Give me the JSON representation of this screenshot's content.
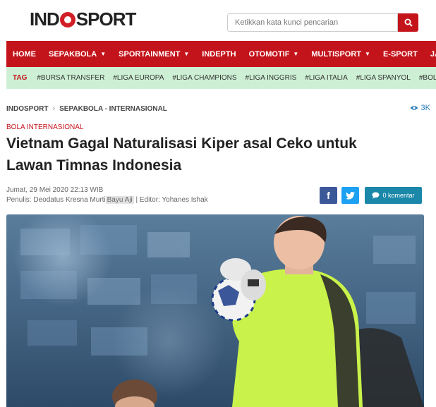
{
  "header": {
    "logo_text_left": "IND",
    "logo_text_right": "SPORT",
    "search_placeholder": "Ketikkan kata kunci pencarian"
  },
  "nav": {
    "items": [
      {
        "label": "HOME",
        "dropdown": false
      },
      {
        "label": "SEPAKBOLA",
        "dropdown": true
      },
      {
        "label": "SPORTAINMENT",
        "dropdown": true
      },
      {
        "label": "INDEPTH",
        "dropdown": false
      },
      {
        "label": "OTOMOTIF",
        "dropdown": true
      },
      {
        "label": "MULTISPORT",
        "dropdown": true
      },
      {
        "label": "E-SPORT",
        "dropdown": false
      },
      {
        "label": "JADWA",
        "dropdown": false
      }
    ]
  },
  "tagbar": {
    "label": "TAG",
    "tags": [
      "#BURSA TRANSFER",
      "#LIGA EUROPA",
      "#LIGA CHAMPIONS",
      "#LIGA INGGRIS",
      "#LIGA ITALIA",
      "#LIGA SPANYOL",
      "#BOLA INTERNASIONAL"
    ]
  },
  "breadcrumb": {
    "home": "INDOSPORT",
    "section": "SEPAKBOLA - INTERNASIONAL"
  },
  "views": "3K",
  "article": {
    "category": "BOLA INTERNASIONAL",
    "title_line1": "Vietnam Gagal Naturalisasi Kiper asal Ceko untuk",
    "title_line2": "Lawan Timnas Indonesia",
    "date": "Jumat, 29 Mei 2020 22:13 WIB",
    "writer_prefix": "Penulis: Deodatus Kresna Murti",
    "writer_highlight": "Bayu Aji",
    "editor": "| Editor: Yohanes Ishak"
  },
  "share": {
    "comment_label": "0 komentar"
  },
  "colors": {
    "brand_red": "#c4141b",
    "tag_bg": "#cdf0d4",
    "facebook": "#3b5998",
    "twitter": "#1da1f2",
    "comment": "#1b87a9",
    "keeper_jersey": "#c9f24a"
  }
}
